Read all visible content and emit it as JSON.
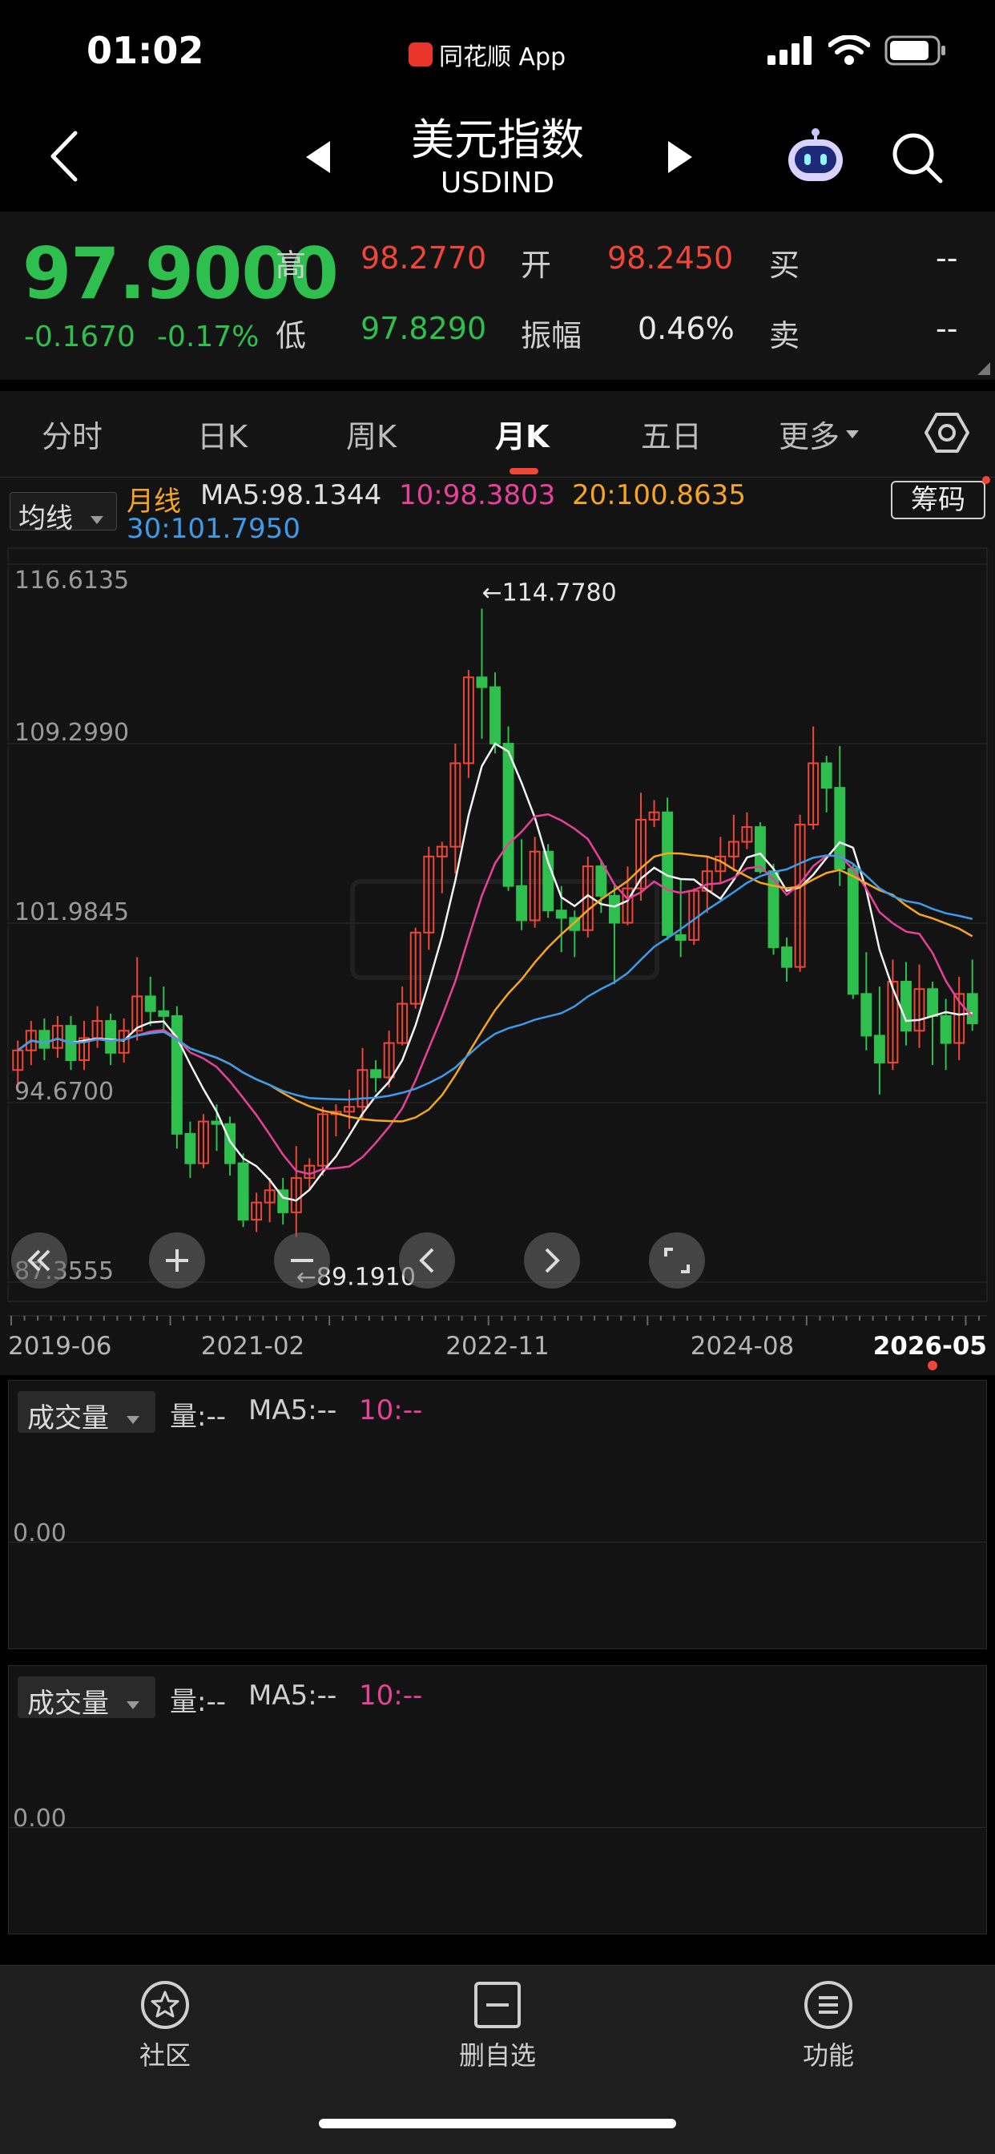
{
  "status": {
    "time": "01:02",
    "app_name": "同花顺 App"
  },
  "header": {
    "title": "美元指数",
    "subtitle": "USDIND"
  },
  "quote": {
    "price": "97.9000",
    "change": "-0.1670",
    "change_pct": "-0.17%",
    "high_label": "高",
    "high": "98.2770",
    "low_label": "低",
    "low": "97.8290",
    "open_label": "开",
    "open": "98.2450",
    "amp_label": "振幅",
    "amp": "0.46%",
    "buy_label": "买",
    "buy": "--",
    "sell_label": "卖",
    "sell": "--"
  },
  "tabs": [
    {
      "label": "分时"
    },
    {
      "label": "日K"
    },
    {
      "label": "周K"
    },
    {
      "label": "月K"
    },
    {
      "label": "五日"
    },
    {
      "label": "更多"
    }
  ],
  "ma": {
    "selector": "均线",
    "period": "月线",
    "ma5": "MA5:98.1344",
    "ma10": "10:98.3803",
    "ma20": "20:100.8635",
    "ma30": "30:101.7950",
    "chip_button": "筹码"
  },
  "colors": {
    "up": "#ef4637",
    "down": "#2fbf4e",
    "ma5": "#f2f2f2",
    "ma10": "#e8419a",
    "ma20": "#f5a623",
    "ma30": "#3d9be9"
  },
  "chart_data": {
    "type": "candlestick",
    "y_ticks": [
      "116.6135",
      "109.2990",
      "101.9845",
      "94.6700",
      "87.3555"
    ],
    "ylim": [
      87.3555,
      116.6135
    ],
    "x_ticks": [
      "2019-06",
      "2021-02",
      "2022-11",
      "2024-08",
      "2026-05"
    ],
    "max_label": "←114.7780",
    "min_label": "←89.1910",
    "candles": [
      [
        96.0,
        96.8,
        95.3,
        97.2
      ],
      [
        96.8,
        97.6,
        96.2,
        98.0
      ],
      [
        97.6,
        96.9,
        96.4,
        98.1
      ],
      [
        96.9,
        97.8,
        96.5,
        98.2
      ],
      [
        97.8,
        96.4,
        96.0,
        98.2
      ],
      [
        96.4,
        97.3,
        96.0,
        98.0
      ],
      [
        97.3,
        98.0,
        96.9,
        98.6
      ],
      [
        98.0,
        96.7,
        96.2,
        98.3
      ],
      [
        96.7,
        97.6,
        96.3,
        98.1
      ],
      [
        97.6,
        99.0,
        97.2,
        100.6
      ],
      [
        99.0,
        98.4,
        97.8,
        99.8
      ],
      [
        98.4,
        98.2,
        97.5,
        99.4
      ],
      [
        98.2,
        93.4,
        92.8,
        98.6
      ],
      [
        93.4,
        92.2,
        91.6,
        93.9
      ],
      [
        92.2,
        93.9,
        92.0,
        94.2
      ],
      [
        93.9,
        93.8,
        92.7,
        94.6
      ],
      [
        93.8,
        92.2,
        91.7,
        94.1
      ],
      [
        92.2,
        89.9,
        89.6,
        92.6
      ],
      [
        89.9,
        90.6,
        89.4,
        91.0
      ],
      [
        90.6,
        91.1,
        89.8,
        91.6
      ],
      [
        91.1,
        90.2,
        89.7,
        91.6
      ],
      [
        90.2,
        91.6,
        89.2,
        92.9
      ],
      [
        91.6,
        92.1,
        91.1,
        92.4
      ],
      [
        92.1,
        94.2,
        91.7,
        94.5
      ],
      [
        94.2,
        94.3,
        93.3,
        94.6
      ],
      [
        94.3,
        94.5,
        93.6,
        95.2
      ],
      [
        94.5,
        96.0,
        94.0,
        96.9
      ],
      [
        96.0,
        95.7,
        95.1,
        96.4
      ],
      [
        95.7,
        97.1,
        95.3,
        97.6
      ],
      [
        97.1,
        98.7,
        97.0,
        99.4
      ],
      [
        98.7,
        101.6,
        98.5,
        101.8
      ],
      [
        101.6,
        104.7,
        100.9,
        105.1
      ],
      [
        104.7,
        105.1,
        103.2,
        105.3
      ],
      [
        105.1,
        108.5,
        104.0,
        109.3
      ],
      [
        108.5,
        112.0,
        107.9,
        112.3
      ],
      [
        112.0,
        111.6,
        109.5,
        114.8
      ],
      [
        111.6,
        109.3,
        108.9,
        112.2
      ],
      [
        109.3,
        103.5,
        103.3,
        110.0
      ],
      [
        103.5,
        102.1,
        101.7,
        105.4
      ],
      [
        102.1,
        104.9,
        101.8,
        105.5
      ],
      [
        104.9,
        102.5,
        102.2,
        105.2
      ],
      [
        102.5,
        102.2,
        100.8,
        103.5
      ],
      [
        102.2,
        101.7,
        100.6,
        102.5
      ],
      [
        101.7,
        104.3,
        101.4,
        104.7
      ],
      [
        104.3,
        103.1,
        102.4,
        104.5
      ],
      [
        103.1,
        102.0,
        99.5,
        103.5
      ],
      [
        102.0,
        103.4,
        101.9,
        104.3
      ],
      [
        103.4,
        106.2,
        102.9,
        107.3
      ],
      [
        106.2,
        106.5,
        105.9,
        107.0
      ],
      [
        106.5,
        101.5,
        101.3,
        107.1
      ],
      [
        101.5,
        101.3,
        100.6,
        103.8
      ],
      [
        101.3,
        103.3,
        101.1,
        103.4
      ],
      [
        103.3,
        104.1,
        102.4,
        104.7
      ],
      [
        104.1,
        104.7,
        103.6,
        105.5
      ],
      [
        104.7,
        105.3,
        104.1,
        106.4
      ],
      [
        105.3,
        105.9,
        105.0,
        106.5
      ],
      [
        105.9,
        104.1,
        104.0,
        106.1
      ],
      [
        104.1,
        101.0,
        100.7,
        104.4
      ],
      [
        101.0,
        100.2,
        99.6,
        101.4
      ],
      [
        100.2,
        106.0,
        100.0,
        106.4
      ],
      [
        106.0,
        108.5,
        105.8,
        110.0
      ],
      [
        108.5,
        107.5,
        106.5,
        108.8
      ],
      [
        107.5,
        104.2,
        103.5,
        109.2
      ],
      [
        104.2,
        99.1,
        98.9,
        104.4
      ],
      [
        99.1,
        97.4,
        96.8,
        100.8
      ],
      [
        97.4,
        96.3,
        95.0,
        99.4
      ],
      [
        96.3,
        99.6,
        96.0,
        100.5
      ],
      [
        99.6,
        97.6,
        97.0,
        100.4
      ],
      [
        97.6,
        99.3,
        96.9,
        100.3
      ],
      [
        99.3,
        98.2,
        96.2,
        99.6
      ],
      [
        98.2,
        97.1,
        96.0,
        98.9
      ],
      [
        97.1,
        99.1,
        96.4,
        99.8
      ],
      [
        99.1,
        97.9,
        97.6,
        100.5
      ]
    ]
  },
  "volume_panels": [
    {
      "selector": "成交量",
      "vol": "量:--",
      "ma5": "MA5:--",
      "ma10": "10:--",
      "zero": "0.00"
    },
    {
      "selector": "成交量",
      "vol": "量:--",
      "ma5": "MA5:--",
      "ma10": "10:--",
      "zero": "0.00"
    }
  ],
  "bottom_nav": [
    {
      "label": "社区"
    },
    {
      "label": "删自选"
    },
    {
      "label": "功能"
    }
  ]
}
